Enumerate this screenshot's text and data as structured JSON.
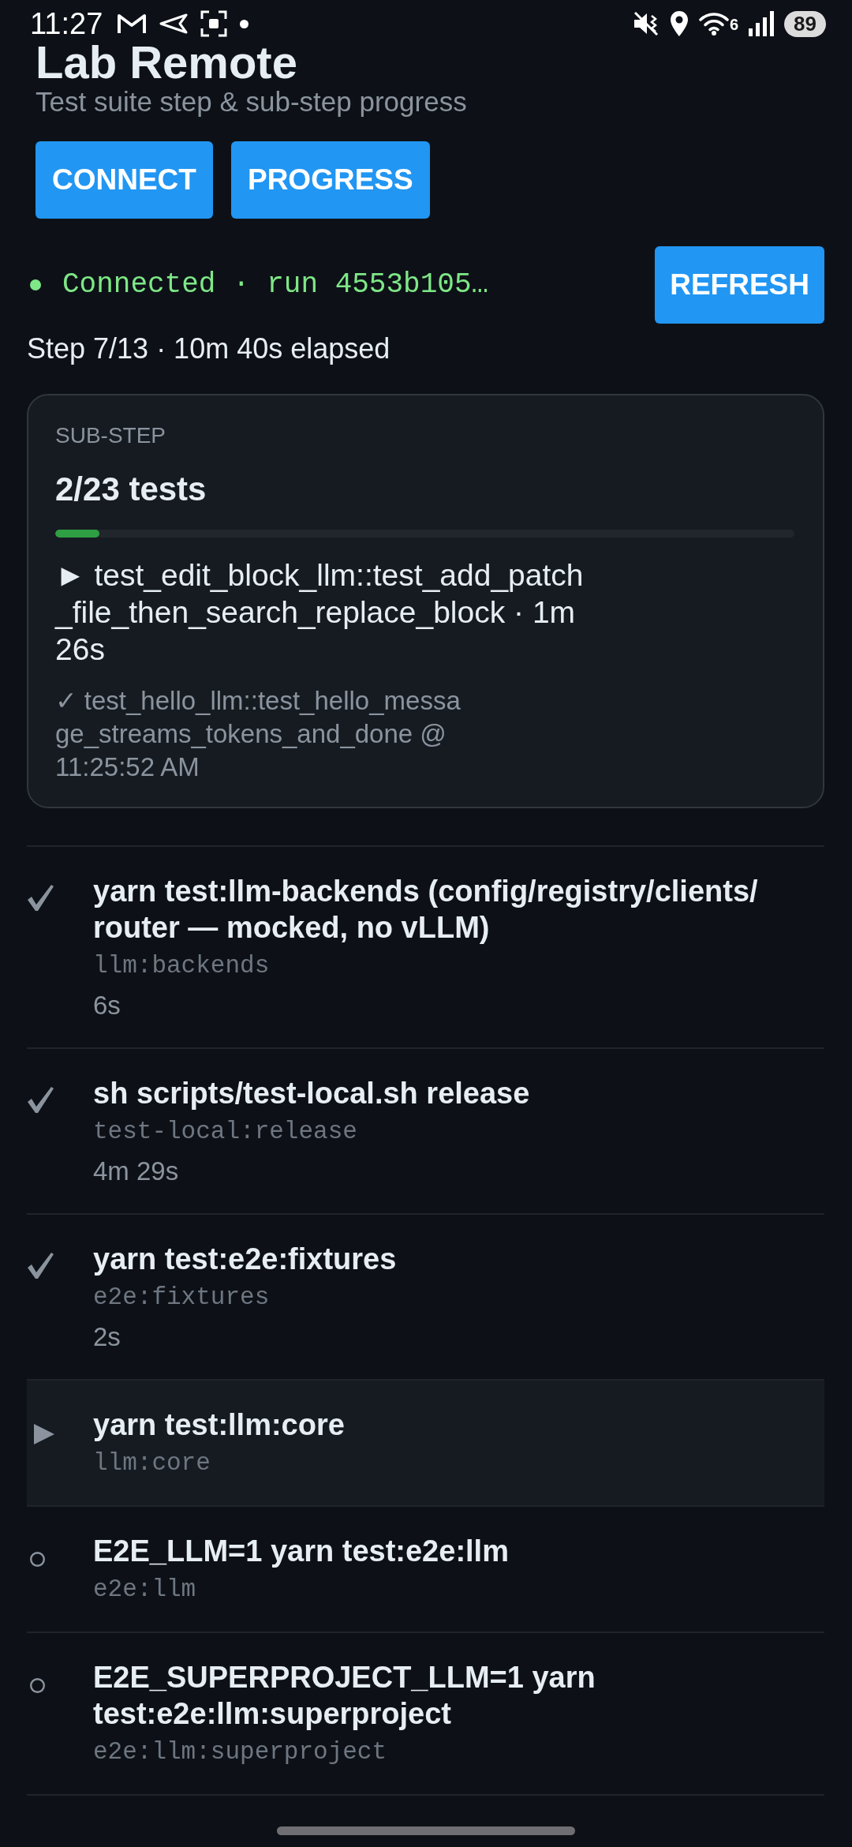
{
  "status_bar": {
    "time": "11:27",
    "wifi_generation": "6",
    "battery": "89"
  },
  "header": {
    "title": "Lab Remote",
    "subtitle": "Test suite step & sub-step progress"
  },
  "actions": [
    {
      "label": "CONNECT"
    },
    {
      "label": "PROGRESS"
    }
  ],
  "connection": {
    "connected": true,
    "text": "Connected · run 4553b105…",
    "refresh_label": "REFRESH"
  },
  "step_summary": "Step 7/13 · 10m 40s elapsed",
  "sub_step": {
    "label": "SUB-STEP",
    "count": "2/23 tests",
    "level": 0.06,
    "current": "► test_edit_block_llm::test_add_patch_file_then_search_replace_block · 1m 26s",
    "last_done": "✓ test_hello_llm::test_hello_message_streams_tokens_and_done @ 11:25:52 AM"
  },
  "steps": [
    {
      "kind": "done",
      "command": "yarn test:llm-backends (config/registry/clients/ router — mocked, no vLLM)",
      "target": "llm:backends",
      "duration": "6s"
    },
    {
      "kind": "done",
      "command": "sh scripts/test-local.sh release",
      "target": "test-local:release",
      "duration": "4m 29s"
    },
    {
      "kind": "done",
      "command": "yarn test:e2e:fixtures",
      "target": "e2e:fixtures",
      "duration": "2s"
    },
    {
      "kind": "running",
      "command": "yarn test:llm:core",
      "target": "llm:core"
    },
    {
      "kind": "pending",
      "command": "E2E_LLM=1 yarn test:e2e:llm",
      "target": "e2e:llm"
    },
    {
      "kind": "pending",
      "command": "E2E_SUPERPROJECT_LLM=1 yarn test:e2e:llm:superproject",
      "target": "e2e:llm:superproject"
    }
  ]
}
